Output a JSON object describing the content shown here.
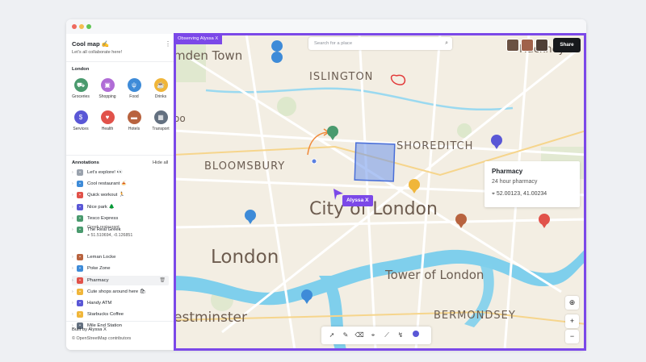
{
  "sidebar": {
    "map_title": "Cool map ✍",
    "subtitle": "Let's all collaborate here!",
    "city_label": "London",
    "categories": [
      {
        "label": "Groceries",
        "icon": "cart-icon",
        "color": "#4a9a6e"
      },
      {
        "label": "Shopping",
        "icon": "bag-icon",
        "color": "#b06cd6"
      },
      {
        "label": "Food",
        "icon": "fork-knife-icon",
        "color": "#3e8bd8"
      },
      {
        "label": "Drinks",
        "icon": "cup-icon",
        "color": "#f0b63a"
      },
      {
        "label": "Services",
        "icon": "dollar-icon",
        "color": "#5a57d6"
      },
      {
        "label": "Health",
        "icon": "heart-icon",
        "color": "#e1524a"
      },
      {
        "label": "Hotels",
        "icon": "bed-icon",
        "color": "#b8633f"
      },
      {
        "label": "Transport",
        "icon": "train-icon",
        "color": "#637080"
      }
    ],
    "annotations_label": "Annotations",
    "hide_all_label": "Hide all",
    "annotations": [
      {
        "label": "Let's explore! 👀",
        "color": "#9aa2ad"
      },
      {
        "label": "Cool restaurant 🍝",
        "color": "#3e8bd8"
      },
      {
        "label": "Quick workout 🏃",
        "color": "#e1524a"
      },
      {
        "label": "Nice park 🌲",
        "color": "#5a57d6"
      },
      {
        "label": "Tesco Express",
        "color": "#4a9a6e"
      },
      {
        "label": "The Real Greek",
        "color": "#4a9a6e"
      },
      {
        "label": "Leman Locke",
        "color": "#b8633f"
      },
      {
        "label": "Poke Zone",
        "color": "#3e8bd8"
      },
      {
        "label": "Pharmacy",
        "color": "#e1524a"
      },
      {
        "label": "Cute shops around here 🛍",
        "color": "#f0b63a"
      },
      {
        "label": "Handy ATM",
        "color": "#5a57d6"
      },
      {
        "label": "Starbucks Coffee",
        "color": "#f0b63a"
      },
      {
        "label": "Mile End Station",
        "color": "#637080"
      }
    ],
    "greek_detail": "Greek restaurant",
    "greek_coords": "51.510694, -0.126851",
    "built_by": "Built by Alyssa X",
    "osm_credit": "© OpenStreetMap contributors"
  },
  "map": {
    "observing_label": "Observing Alyssa X",
    "search_placeholder": "Search for a place",
    "share_label": "Share",
    "cursor_label": "Alyssa X",
    "labels": {
      "camden": "mden Town",
      "islington": "ISLINGTON",
      "bloomsbury": "BLOOMSBURY",
      "shoreditch": "SHOREDITCH",
      "city": "City of London",
      "london": "London",
      "tower": "Tower of London",
      "westminster": "estminster",
      "bermondsey": "BERMONDSEY",
      "hackney": "Hackney",
      "holborn": "oo"
    },
    "popup": {
      "title": "Pharmacy",
      "subtitle": "24 hour pharmacy",
      "coords": "52.00123, 41.00234"
    },
    "zoom_in": "+",
    "zoom_out": "−",
    "accent": "#7b48e8"
  }
}
